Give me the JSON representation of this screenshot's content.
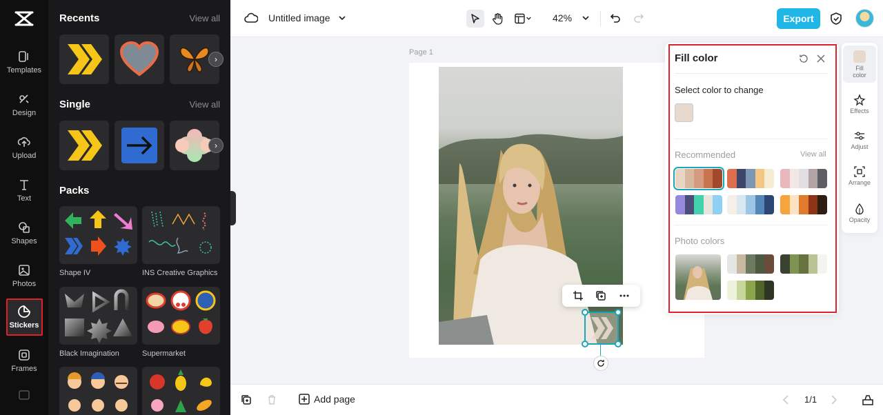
{
  "rail": {
    "items": [
      {
        "label": "Templates",
        "icon": "templates-icon"
      },
      {
        "label": "Design",
        "icon": "design-icon"
      },
      {
        "label": "Upload",
        "icon": "upload-icon"
      },
      {
        "label": "Text",
        "icon": "text-icon"
      },
      {
        "label": "Shapes",
        "icon": "shapes-icon"
      },
      {
        "label": "Photos",
        "icon": "photos-icon"
      },
      {
        "label": "Stickers",
        "icon": "stickers-icon",
        "active": true
      },
      {
        "label": "Frames",
        "icon": "frames-icon"
      }
    ]
  },
  "stickers": {
    "recents": {
      "title": "Recents",
      "view_all": "View all"
    },
    "single": {
      "title": "Single",
      "view_all": "View all"
    },
    "packs": {
      "title": "Packs",
      "items": [
        {
          "label": "Shape IV"
        },
        {
          "label": "INS Creative Graphics"
        },
        {
          "label": "Black Imagination"
        },
        {
          "label": "Supermarket"
        }
      ]
    }
  },
  "topbar": {
    "doc_title": "Untitled image",
    "zoom": "42%",
    "export_label": "Export"
  },
  "canvas": {
    "page_label": "Page 1"
  },
  "fill_panel": {
    "title": "Fill color",
    "select_label": "Select color to change",
    "current_color": "#e8d9cf",
    "recommended_label": "Recommended",
    "recommended_view_all": "View all",
    "photo_colors_label": "Photo colors",
    "recommended_palettes": [
      [
        "#e8d5c4",
        "#d9b79e",
        "#d69a7e",
        "#c7744f",
        "#a2482b"
      ],
      [
        "#df6e4e",
        "#3d4668",
        "#7c97b5",
        "#f2c783",
        "#f6ecd3"
      ],
      [
        "#e9b8bf",
        "#f3e7e5",
        "#e1dfe4",
        "#b2a3a4",
        "#5e5e64"
      ],
      [
        "#9589de",
        "#4b4d7b",
        "#44d2ad",
        "#e7e6dd",
        "#8fd0f5"
      ],
      [
        "#f5efe8",
        "#d8e7f0",
        "#9cc6e3",
        "#5486b9",
        "#2d4774"
      ],
      [
        "#f8a43c",
        "#fde3c4",
        "#e07a2c",
        "#8e3316",
        "#2d1d13"
      ]
    ],
    "photo_palettes": [
      [
        "#e4e6e4",
        "#c8b8a0",
        "#6e7a60",
        "#4d5a42",
        "#6b4c3a"
      ],
      [
        "#3a4232",
        "#7f9450",
        "#66733f",
        "#b9c394",
        "#f3f4ef"
      ],
      [
        "#eef2dc",
        "#c7d69a",
        "#8ca44c",
        "#4f6428",
        "#2f3523"
      ]
    ]
  },
  "properties": {
    "items": [
      {
        "label": "Fill color",
        "icon": "fill-color-icon",
        "active": true
      },
      {
        "label": "Effects",
        "icon": "effects-icon"
      },
      {
        "label": "Adjust",
        "icon": "adjust-icon"
      },
      {
        "label": "Arrange",
        "icon": "arrange-icon"
      },
      {
        "label": "Opacity",
        "icon": "opacity-icon"
      }
    ]
  },
  "bottombar": {
    "add_page_label": "Add page",
    "pager": "1/1"
  },
  "colors": {
    "accent": "#20b7e7",
    "selection": "#19a6b9",
    "highlight_outline": "#e0202a",
    "sticker_yellow": "#f5c518"
  }
}
